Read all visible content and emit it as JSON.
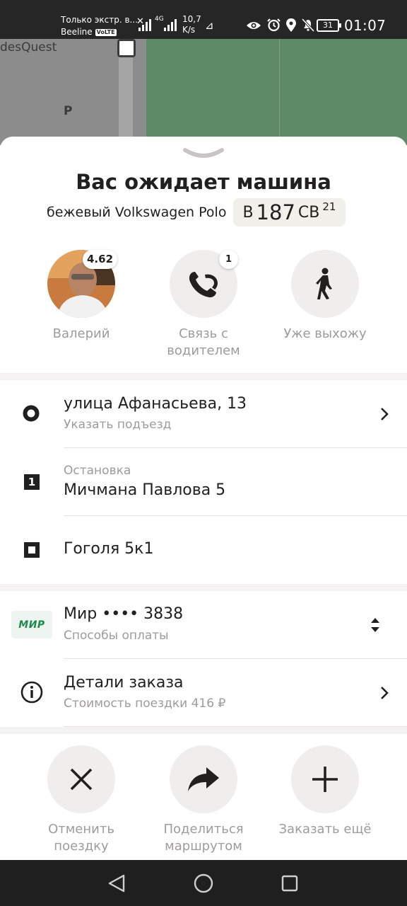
{
  "status_bar": {
    "carrier_line1": "Только экстр. в...",
    "carrier_line2": "Beeline",
    "volte": "VoLTE",
    "net": "4G",
    "speed_value": "10,7",
    "speed_unit": "K/s",
    "battery": "31",
    "time": "01:07"
  },
  "map": {
    "poi_label": "desQuest",
    "parking_label": "P"
  },
  "header": {
    "title": "Вас ожидает машина",
    "car_description": "бежевый Volkswagen Polo",
    "plate": {
      "letter1": "В",
      "number": "187",
      "letters": "СВ",
      "region": "21"
    }
  },
  "driver": {
    "name": "Валерий",
    "rating": "4.62"
  },
  "actions": {
    "contact_label": "Связь с водителем",
    "contact_badge": "1",
    "going_out_label": "Уже выхожу"
  },
  "route": {
    "start_address": "улица Афанасьева, 13",
    "start_hint": "Указать подъезд",
    "stop_number": "1",
    "stop_caption": "Остановка",
    "stop_address": "Мичмана Павлова 5",
    "destination": "Гоголя 5к1"
  },
  "payment": {
    "card_brand": "МИР",
    "card_label": "Мир •••• 3838",
    "methods_label": "Способы оплаты"
  },
  "order_details": {
    "title": "Детали заказа",
    "cost": "Стоимость поездки 416 ₽"
  },
  "bottom_actions": {
    "cancel": "Отменить поездку",
    "share": "Поделиться маршрутом",
    "order_more": "Заказать ещё"
  },
  "colors": {
    "accent_text": "#21201f",
    "muted_text": "#9e9b98",
    "circle_bg": "#f0eeec",
    "mir_green": "#1b8a4a"
  }
}
